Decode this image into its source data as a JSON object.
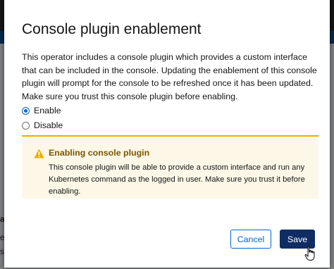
{
  "background": {
    "fragments": [
      "a",
      "e",
      "s"
    ]
  },
  "modal": {
    "title": "Console plugin enablement",
    "description": "This operator includes a console plugin which provides a custom interface that can be included in the console. Updating the enablement of this console plugin will prompt for the console to be refreshed once it has been updated. Make sure you trust this console plugin before enabling.",
    "options": [
      {
        "label": "Enable",
        "checked": true
      },
      {
        "label": "Disable",
        "checked": false
      }
    ],
    "alert": {
      "icon": "warning-triangle-icon",
      "title": "Enabling console plugin",
      "body": "This console plugin will be able to provide a custom interface and run any Kubernetes command as the logged in user. Make sure you trust it before enabling.",
      "accent_color": "#f0ab00",
      "background_color": "#fdf7e7",
      "title_color": "#795600"
    },
    "buttons": {
      "cancel_label": "Cancel",
      "save_label": "Save"
    }
  },
  "colors": {
    "primary": "#0066cc",
    "save_button": "#0f2c63"
  }
}
